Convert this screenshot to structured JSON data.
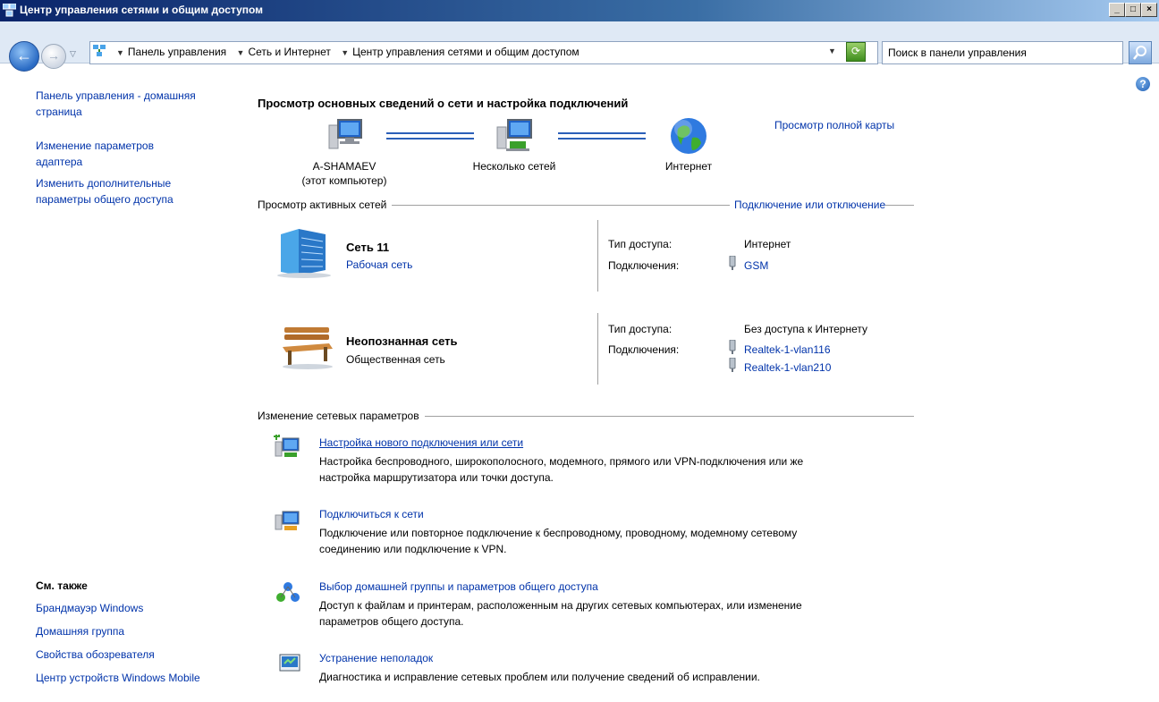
{
  "window": {
    "title": "Центр управления сетями и общим доступом"
  },
  "address": {
    "breadcrumbs": [
      "Панель управления",
      "Сеть и Интернет",
      "Центр управления сетями и общим доступом"
    ],
    "search_placeholder": "Поиск в панели управления"
  },
  "sidebar": {
    "links": [
      "Панель управления - домашняя",
      "страница",
      "Изменение параметров",
      "адаптера",
      "Изменить дополнительные",
      "параметры общего доступа"
    ],
    "see_also_title": "См. также",
    "see_also": [
      "Брандмауэр Windows",
      "Домашняя группа",
      "Свойства обозревателя",
      "Центр устройств Windows Mobile"
    ]
  },
  "main": {
    "heading": "Просмотр основных сведений о сети и настройка подключений",
    "full_map_link": "Просмотр полной карты",
    "map": {
      "computer_name": "A-SHAMAEV",
      "computer_sub": "(этот компьютер)",
      "multiple_networks": "Несколько сетей",
      "internet": "Интернет"
    },
    "active_networks_title": "Просмотр активных сетей",
    "connect_disconnect_link": "Подключение или отключение",
    "networks": [
      {
        "name": "Сеть  11",
        "type": "Рабочая сеть",
        "access_label": "Тип доступа:",
        "access_value": "Интернет",
        "connections_label": "Подключения:",
        "connections": [
          "GSM"
        ]
      },
      {
        "name": "Неопознанная сеть",
        "type": "Общественная сеть",
        "access_label": "Тип доступа:",
        "access_value": "Без доступа к Интернету",
        "connections_label": "Подключения:",
        "connections": [
          "Realtek-1-vlan116",
          "Realtek-1-vlan210"
        ]
      }
    ],
    "change_settings_title": "Изменение сетевых параметров",
    "tasks": [
      {
        "title": "Настройка нового подключения или сети",
        "desc": [
          "Настройка беспроводного, широкополосного, модемного, прямого или VPN-подключения или же",
          "настройка маршрутизатора или точки доступа."
        ]
      },
      {
        "title": "Подключиться к сети",
        "desc": [
          "Подключение или повторное подключение к беспроводному, проводному, модемному сетевому",
          "соединению или подключение к VPN."
        ]
      },
      {
        "title": "Выбор домашней группы и параметров общего доступа",
        "desc": [
          "Доступ к файлам и принтерам, расположенным на других сетевых компьютерах, или изменение",
          "параметров общего доступа."
        ]
      },
      {
        "title": "Устранение неполадок",
        "desc": [
          "Диагностика и исправление сетевых проблем или получение сведений об исправлении."
        ]
      }
    ]
  }
}
